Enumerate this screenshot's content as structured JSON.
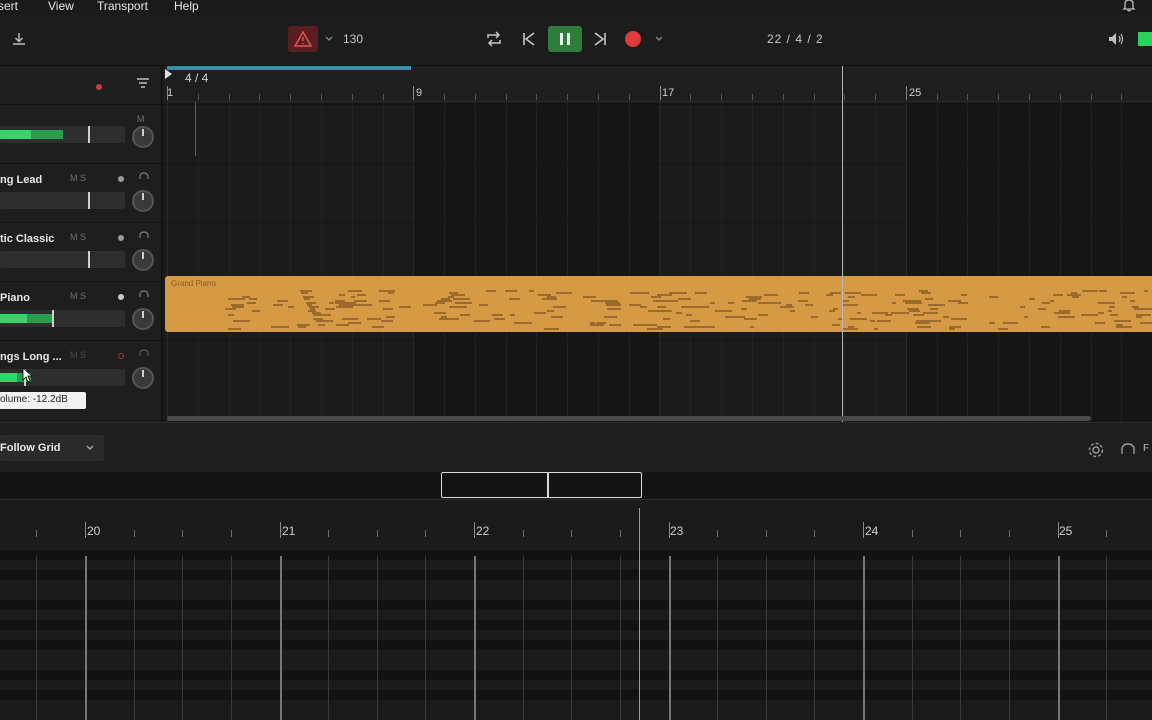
{
  "menu": {
    "items": [
      "Insert",
      "View",
      "Transport",
      "Help"
    ],
    "visible": [
      "sert",
      "View",
      "Transport",
      "Help"
    ]
  },
  "transport": {
    "tempo": "130",
    "position": "22  /  4  /  2",
    "metronome_icon": "warning-triangle-icon",
    "play_state": "playing"
  },
  "tracks": [
    {
      "name": "",
      "meter_level": 0.25,
      "meter_peak": 0.5,
      "fader_value": 0.72,
      "show_ms": "M"
    },
    {
      "name": "ng Lead",
      "meter_level": 0,
      "fader_value": 0.72,
      "show_ms": "M   S"
    },
    {
      "name": "tic Classic",
      "meter_level": 0,
      "fader_value": 0.72,
      "show_ms": "M   S"
    },
    {
      "name": "Piano",
      "meter_level": 0.22,
      "meter_peak": 0.45,
      "fader_value": 0.45,
      "show_ms": "M   S"
    },
    {
      "name": "ngs Long ...",
      "meter_level": 0.14,
      "meter_peak": 0.25,
      "fader_value": 0.2,
      "show_ms": "M   S"
    }
  ],
  "volume_tooltip": "olume: -12.2dB",
  "arrange": {
    "time_signature": "4 / 4",
    "bar_labels": [
      "1",
      "9",
      "17",
      "25"
    ],
    "clip": {
      "name": "Grand Piano",
      "color": "#d69a45"
    }
  },
  "editor": {
    "snap_mode": "Follow Grid",
    "bar_labels": [
      "20",
      "21",
      "22",
      "23",
      "24",
      "25"
    ],
    "extra_label": "F"
  },
  "colors": {
    "accent_green": "#38d66a",
    "record_red": "#e03b3b",
    "clip_orange": "#d69a45"
  }
}
